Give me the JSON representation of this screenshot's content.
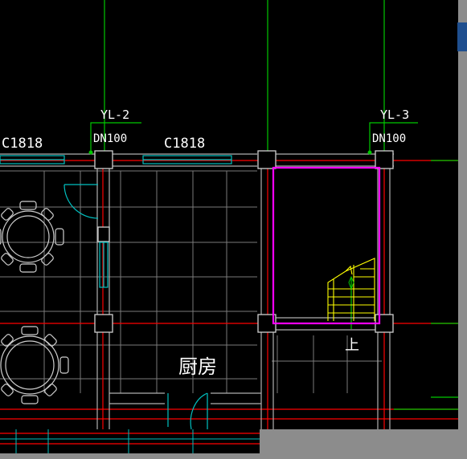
{
  "labels": {
    "pipe_left": "YL-2",
    "pipe_right": "YL-3",
    "dn_left": "DN100",
    "dn_right": "DN100",
    "window_left": "C1818",
    "window_mid": "C1818",
    "room_name": "厨房",
    "stair_up": "上"
  },
  "colors": {
    "canvas": "#000000",
    "frame": "#8c8c8c",
    "accent_blue": "#1f4f8f",
    "wall": "#9a9a9a",
    "axis_red": "#ff0000",
    "green": "#00c800",
    "cyan": "#00c0c0",
    "magenta": "#ff00ff",
    "yellow": "#ffff00",
    "text": "#ffffff"
  },
  "icons": {
    "table_set": "round-table-with-chairs-icon",
    "door": "door-swing-icon",
    "stair": "stair-symbol-icon"
  }
}
